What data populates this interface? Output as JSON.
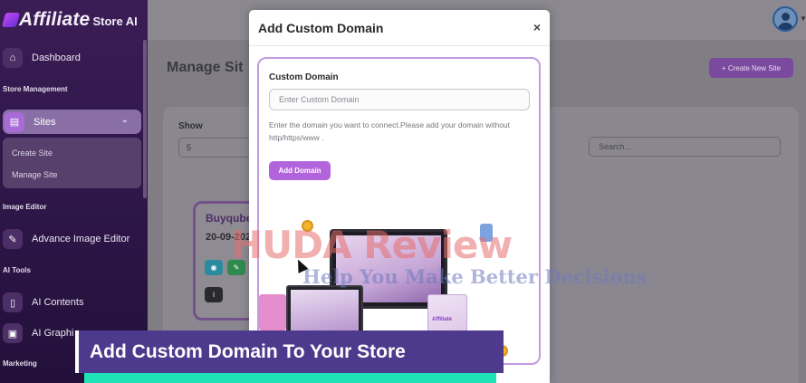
{
  "sidebar": {
    "logo_main": "Affiliate",
    "logo_sub": "Store AI",
    "dashboard": "Dashboard",
    "section_store": "Store Management",
    "sites": "Sites",
    "create_site": "Create Site",
    "manage_site": "Manage Site",
    "section_image": "Image Editor",
    "advance_editor": "Advance Image Editor",
    "section_ai": "AI Tools",
    "ai_contents": "AI Contents",
    "ai_graphics": "AI Graphi",
    "section_marketing": "Marketing"
  },
  "main": {
    "page_title": "Manage Sit",
    "create_button": "+ Create New Site",
    "show_label": "Show",
    "show_value": "5",
    "search_placeholder": "Search...",
    "card": {
      "name": "Buyqube",
      "date": "20-09-2025"
    }
  },
  "modal": {
    "title": "Add Custom Domain",
    "close": "×",
    "field_label": "Custom Domain",
    "input_placeholder": "Enter Custom Domain",
    "hint": "Enter the domain you want to connect.Please add your domain without http/https/www .",
    "button": "Add Domain",
    "box_logo": "Affiliate"
  },
  "watermark": {
    "main": "HUDA Review",
    "sub": "Help You Make Better Decisions"
  },
  "caption": "Add Custom Domain To Your Store",
  "colors": {
    "accent": "#b264dc",
    "sidebar": "#2d1648",
    "caption_bg": "#4d3a8c",
    "caption_underline": "#1fe3b8"
  }
}
